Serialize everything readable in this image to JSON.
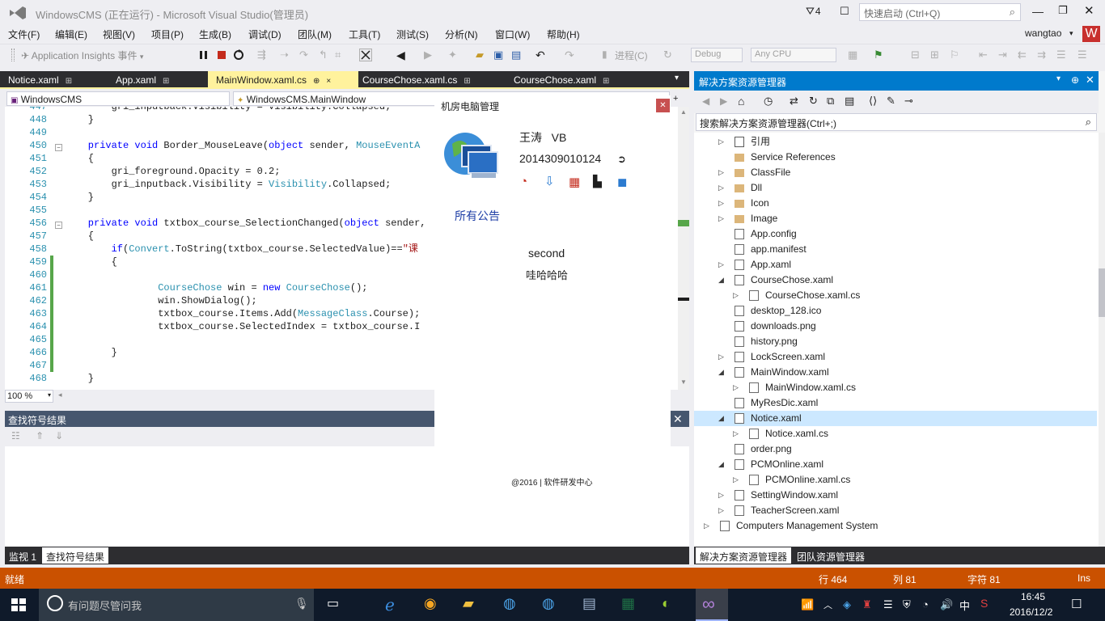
{
  "title_bar": {
    "title": "WindowsCMS (正在运行) - Microsoft Visual Studio(管理员)",
    "notifications": "4",
    "quick_launch_placeholder": "快速启动 (Ctrl+Q)"
  },
  "menu": {
    "items": [
      "文件(F)",
      "编辑(E)",
      "视图(V)",
      "项目(P)",
      "生成(B)",
      "调试(D)",
      "团队(M)",
      "工具(T)",
      "测试(S)",
      "分析(N)",
      "窗口(W)",
      "帮助(H)"
    ],
    "user": "wangtao",
    "user_badge": "W"
  },
  "toolbar": {
    "app_insights": "Application Insights 事件",
    "process": "进程(C)",
    "config": "Debug",
    "platform": "Any CPU"
  },
  "doc_tabs": [
    {
      "label": "Notice.xaml",
      "pin": "⊞"
    },
    {
      "label": "App.xaml",
      "pin": "⊞"
    },
    {
      "label": "MainWindow.xaml.cs",
      "pin": "⊕",
      "close": "×"
    },
    {
      "label": "CourseChose.xaml.cs",
      "pin": "⊞"
    },
    {
      "label": "CourseChose.xaml",
      "pin": "⊞"
    }
  ],
  "nav": {
    "project": "WindowsCMS",
    "class": "WindowsCMS.MainWindow"
  },
  "code_lines": [
    {
      "n": "447",
      "parts": [
        [
          "",
          "        gri_inputback.Visibility = Visibility.Collapsed;"
        ]
      ]
    },
    {
      "n": "448",
      "parts": [
        [
          "",
          "    }"
        ]
      ]
    },
    {
      "n": "449",
      "parts": [
        [
          "",
          ""
        ]
      ]
    },
    {
      "n": "450",
      "parts": [
        [
          "kw",
          "    private void"
        ],
        [
          "",
          " Border_MouseLeave("
        ],
        [
          "kw",
          "object"
        ],
        [
          "",
          " sender, "
        ],
        [
          "ty",
          "MouseEventA"
        ]
      ]
    },
    {
      "n": "451",
      "parts": [
        [
          "",
          "    {"
        ]
      ]
    },
    {
      "n": "452",
      "parts": [
        [
          "",
          "        gri_foreground.Opacity = 0.2;"
        ]
      ]
    },
    {
      "n": "453",
      "parts": [
        [
          "",
          "        gri_inputback.Visibility = "
        ],
        [
          "ty",
          "Visibility"
        ],
        [
          "",
          ".Collapsed;"
        ]
      ]
    },
    {
      "n": "454",
      "parts": [
        [
          "",
          "    }"
        ]
      ]
    },
    {
      "n": "455",
      "parts": [
        [
          "",
          ""
        ]
      ]
    },
    {
      "n": "456",
      "parts": [
        [
          "kw",
          "    private void"
        ],
        [
          "",
          " txtbox_course_SelectionChanged("
        ],
        [
          "kw",
          "object"
        ],
        [
          "",
          " sender,"
        ]
      ]
    },
    {
      "n": "457",
      "parts": [
        [
          "",
          "    {"
        ]
      ]
    },
    {
      "n": "458",
      "parts": [
        [
          "kw",
          "        if"
        ],
        [
          "",
          "("
        ],
        [
          "ty",
          "Convert"
        ],
        [
          "",
          ".ToString(txtbox_course.SelectedValue)=="
        ],
        [
          "st",
          "\"课"
        ]
      ]
    },
    {
      "n": "459",
      "parts": [
        [
          "",
          "        {"
        ]
      ]
    },
    {
      "n": "460",
      "parts": [
        [
          "",
          ""
        ]
      ]
    },
    {
      "n": "461",
      "parts": [
        [
          "ty",
          "                CourseChose"
        ],
        [
          "",
          " win = "
        ],
        [
          "kw",
          "new"
        ],
        [
          "ty",
          " CourseChose"
        ],
        [
          "",
          "();"
        ]
      ]
    },
    {
      "n": "462",
      "parts": [
        [
          "",
          "                win.ShowDialog();"
        ]
      ]
    },
    {
      "n": "463",
      "parts": [
        [
          "",
          "                txtbox_course.Items.Add("
        ],
        [
          "ty",
          "MessageClass"
        ],
        [
          "",
          ".Course);"
        ]
      ]
    },
    {
      "n": "464",
      "parts": [
        [
          "",
          "                txtbox_course.SelectedIndex = txtbox_course.I"
        ]
      ]
    },
    {
      "n": "465",
      "parts": [
        [
          "",
          ""
        ]
      ]
    },
    {
      "n": "466",
      "parts": [
        [
          "",
          "        }"
        ]
      ]
    },
    {
      "n": "467",
      "parts": [
        [
          "",
          ""
        ]
      ]
    },
    {
      "n": "468",
      "parts": [
        [
          "",
          "    }"
        ]
      ]
    }
  ],
  "editor": {
    "zoom": "100 %"
  },
  "find_panel": {
    "title": "查找符号结果"
  },
  "bottom_tabs": [
    "监视 1",
    "查找符号结果"
  ],
  "notice_window": {
    "title": "机房电脑管理",
    "user_name": "王涛",
    "user_level": "VB",
    "user_id": "2014309010124",
    "announcements_link": "所有公告",
    "message_title": "second",
    "message_body": "哇哈哈哈",
    "copyright": "@2016 | 软件研发中心"
  },
  "solution_explorer": {
    "title": "解决方案资源管理器",
    "search_placeholder": "搜索解决方案资源管理器(Ctrl+;)",
    "items": [
      {
        "label": "引用",
        "indent": 1,
        "expander": "▷",
        "icon": "references-icon",
        "color": "#5a5a5a"
      },
      {
        "label": "Service References",
        "indent": 1,
        "expander": "",
        "icon": "folder-icon",
        "color": "#dcb67a"
      },
      {
        "label": "ClassFile",
        "indent": 1,
        "expander": "▷",
        "icon": "folder-icon",
        "color": "#dcb67a"
      },
      {
        "label": "Dll",
        "indent": 1,
        "expander": "▷",
        "icon": "folder-icon",
        "color": "#dcb67a"
      },
      {
        "label": "Icon",
        "indent": 1,
        "expander": "▷",
        "icon": "folder-icon",
        "color": "#dcb67a"
      },
      {
        "label": "Image",
        "indent": 1,
        "expander": "▷",
        "icon": "folder-icon",
        "color": "#dcb67a"
      },
      {
        "label": "App.config",
        "indent": 1,
        "expander": "",
        "icon": "config-file-icon",
        "color": "#6a6a6a"
      },
      {
        "label": "app.manifest",
        "indent": 1,
        "expander": "",
        "icon": "manifest-file-icon",
        "color": "#6a6a6a"
      },
      {
        "label": "App.xaml",
        "indent": 1,
        "expander": "▷",
        "icon": "xaml-file-icon",
        "color": "#6a6a6a"
      },
      {
        "label": "CourseChose.xaml",
        "indent": 1,
        "expander": "◢",
        "icon": "xaml-file-icon",
        "color": "#6a6a6a"
      },
      {
        "label": "CourseChose.xaml.cs",
        "indent": 2,
        "expander": "▷",
        "icon": "cs-file-icon",
        "color": "#6a6a6a"
      },
      {
        "label": "desktop_128.ico",
        "indent": 1,
        "expander": "",
        "icon": "ico-file-icon",
        "color": "#6a6a6a"
      },
      {
        "label": "downloads.png",
        "indent": 1,
        "expander": "",
        "icon": "image-file-icon",
        "color": "#6a6a6a"
      },
      {
        "label": "history.png",
        "indent": 1,
        "expander": "",
        "icon": "image-file-icon",
        "color": "#6a6a6a"
      },
      {
        "label": "LockScreen.xaml",
        "indent": 1,
        "expander": "▷",
        "icon": "xaml-file-icon",
        "color": "#6a6a6a"
      },
      {
        "label": "MainWindow.xaml",
        "indent": 1,
        "expander": "◢",
        "icon": "xaml-file-icon",
        "color": "#6a6a6a"
      },
      {
        "label": "MainWindow.xaml.cs",
        "indent": 2,
        "expander": "▷",
        "icon": "cs-file-icon",
        "color": "#6a6a6a"
      },
      {
        "label": "MyResDic.xaml",
        "indent": 1,
        "expander": "",
        "icon": "xaml-file-icon",
        "color": "#6a6a6a"
      },
      {
        "label": "Notice.xaml",
        "indent": 1,
        "expander": "◢",
        "icon": "xaml-file-icon",
        "color": "#6a6a6a",
        "selected": true
      },
      {
        "label": "Notice.xaml.cs",
        "indent": 2,
        "expander": "▷",
        "icon": "cs-file-icon",
        "color": "#6a6a6a"
      },
      {
        "label": "order.png",
        "indent": 1,
        "expander": "",
        "icon": "image-file-icon",
        "color": "#6a6a6a"
      },
      {
        "label": "PCMOnline.xaml",
        "indent": 1,
        "expander": "◢",
        "icon": "xaml-file-icon",
        "color": "#6a6a6a"
      },
      {
        "label": "PCMOnline.xaml.cs",
        "indent": 2,
        "expander": "▷",
        "icon": "cs-file-icon",
        "color": "#6a6a6a"
      },
      {
        "label": "SettingWindow.xaml",
        "indent": 1,
        "expander": "▷",
        "icon": "xaml-file-icon",
        "color": "#6a6a6a"
      },
      {
        "label": "TeacherScreen.xaml",
        "indent": 1,
        "expander": "▷",
        "icon": "xaml-file-icon",
        "color": "#6a6a6a"
      },
      {
        "label": "Computers Management System",
        "indent": 0,
        "expander": "▷",
        "icon": "project-icon",
        "color": "#6a6a6a"
      }
    ],
    "bottom_tabs": [
      "解决方案资源管理器",
      "团队资源管理器"
    ]
  },
  "status": {
    "state": "就绪",
    "line": "行 464",
    "col": "列 81",
    "ch": "字符 81",
    "mode": "Ins"
  },
  "taskbar": {
    "search_placeholder": "有问题尽管问我",
    "time": "16:45",
    "date": "2016/12/2",
    "ime": "中"
  },
  "colors": {
    "accent": "#007acc",
    "statusbar": "#ca5100",
    "active_tab": "#fff29d",
    "vs_purple": "#68217a"
  }
}
